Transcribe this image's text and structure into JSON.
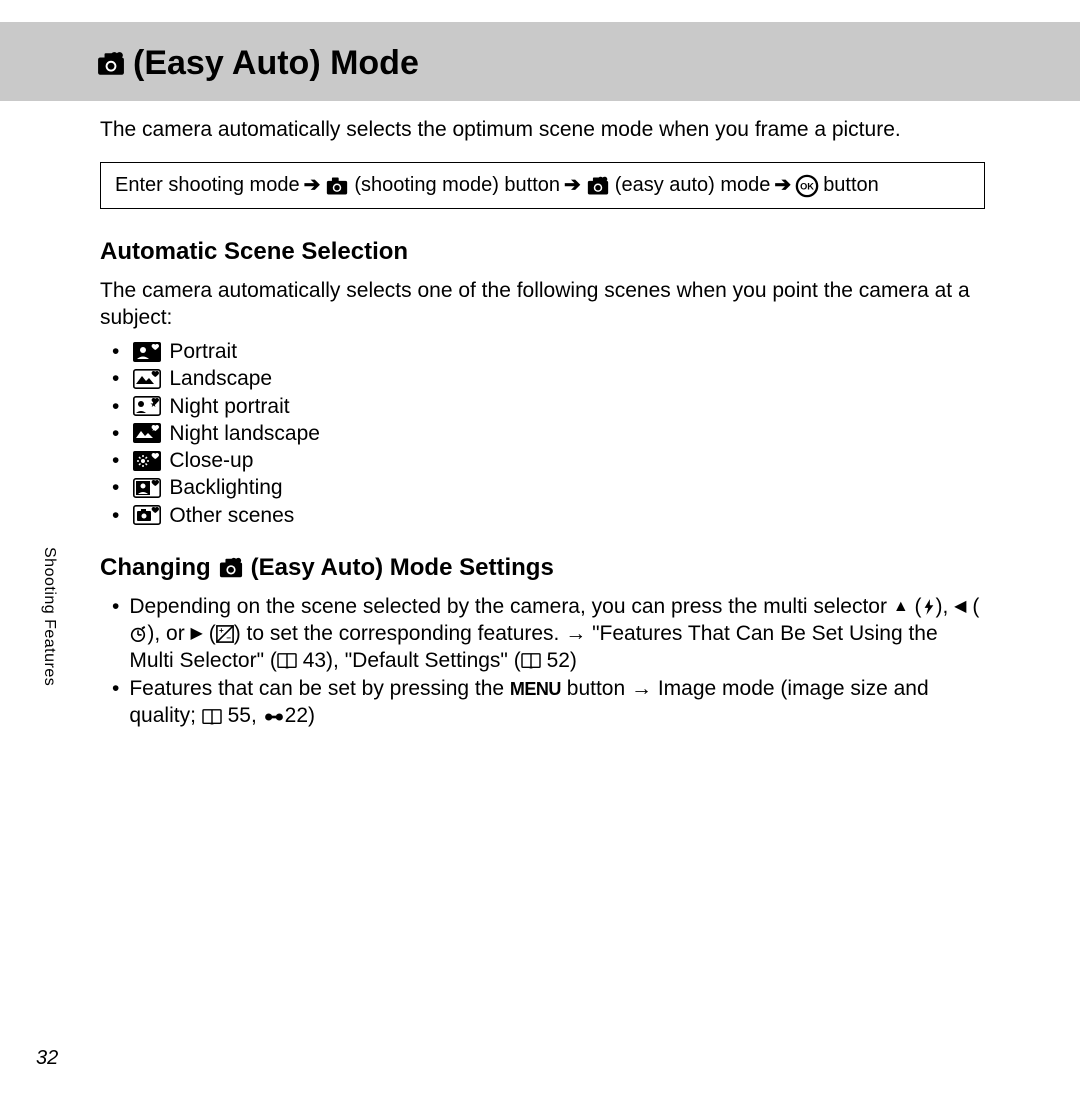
{
  "header": {
    "title": "(Easy Auto) Mode"
  },
  "intro": "The camera automatically selects the optimum scene mode when you frame a picture.",
  "navbox": {
    "t1": "Enter shooting mode",
    "t2": "(shooting mode) button",
    "t3": "(easy auto) mode",
    "t4": "button"
  },
  "section1": {
    "heading": "Automatic Scene Selection",
    "para": "The camera automatically selects one of the following scenes when you point the camera at a subject:",
    "scenes": {
      "s0": "Portrait",
      "s1": "Landscape",
      "s2": "Night portrait",
      "s3": "Night landscape",
      "s4": "Close-up",
      "s5": "Backlighting",
      "s6": "Other scenes"
    }
  },
  "section2": {
    "heading_a": "Changing",
    "heading_b": "(Easy Auto) Mode Settings",
    "item1_a": "Depending on the scene selected by the camera, you can press the multi selector",
    "item1_b": "(",
    "item1_c": "),",
    "item1_d": "(",
    "item1_e": "), or",
    "item1_f": "(",
    "item1_g": ") to set the corresponding features.",
    "item1_h": "\"Features That Can Be Set Using the Multi Selector\" (",
    "item1_i": "43), \"Default Settings\" (",
    "item1_j": "52)",
    "item2_a": "Features that can be set by pressing the",
    "item2_b": "button",
    "item2_c": "Image mode (image size and quality;",
    "item2_d": "55,",
    "item2_e": "22)"
  },
  "menu_label": "MENU",
  "side_tab": "Shooting Features",
  "page_number": "32"
}
